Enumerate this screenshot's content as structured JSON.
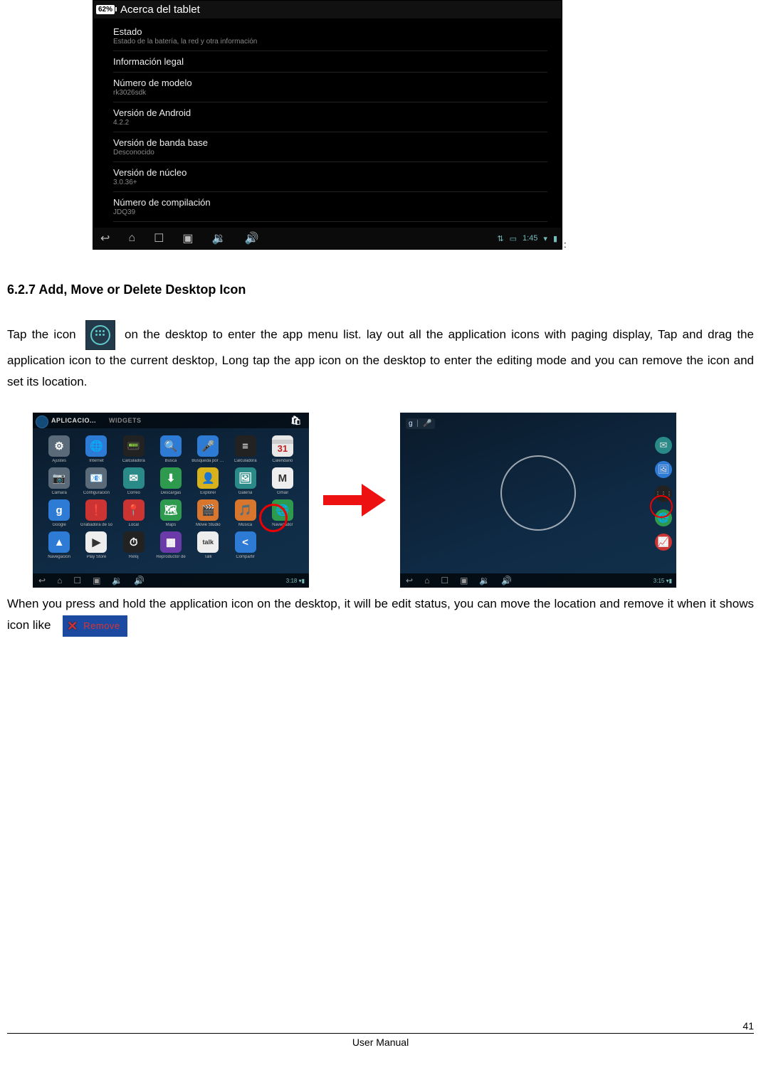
{
  "about": {
    "battery": "62%",
    "title": "Acerca del tablet",
    "items": [
      {
        "title": "Estado",
        "sub": "Estado de la batería, la red y otra información"
      },
      {
        "title": "Información legal",
        "sub": ""
      },
      {
        "title": "Número de modelo",
        "sub": "rk3026sdk"
      },
      {
        "title": "Versión de Android",
        "sub": "4.2.2"
      },
      {
        "title": "Versión de banda base",
        "sub": "Desconocido"
      },
      {
        "title": "Versión de núcleo",
        "sub": "3.0.36+"
      },
      {
        "title": "Número de compilación",
        "sub": "JDQ39"
      }
    ],
    "clock": "1:45"
  },
  "section_heading": "6.2.7 Add, Move or Delete Desktop Icon",
  "para1a": "Tap the icon",
  "para1b": "on the desktop to enter the app menu list.   lay out all the application icons with paging display, Tap and drag the application icon to the current desktop, Long tap the app icon on the desktop to enter the editing mode and you can remove the icon and set its location.",
  "left_shot": {
    "tab1": "APLICACIO...",
    "tab2": "WIDGETS",
    "apps": [
      {
        "lbl": "Ajustes",
        "g": "⚙",
        "cls": "bg-grey"
      },
      {
        "lbl": "Internet",
        "g": "🌐",
        "cls": "bg-blue"
      },
      {
        "lbl": "Calculadora",
        "g": "📟",
        "cls": "bg-dark"
      },
      {
        "lbl": "Busca",
        "g": "🔍",
        "cls": "bg-blue"
      },
      {
        "lbl": "Búsqueda por voz",
        "g": "🎤",
        "cls": "bg-blue"
      },
      {
        "lbl": "Calculadora",
        "g": "≡",
        "cls": "bg-dark"
      },
      {
        "lbl": "Calendario",
        "g": "31",
        "cls": "bg-cal"
      },
      {
        "lbl": "Cámara",
        "g": "📷",
        "cls": "bg-grey"
      },
      {
        "lbl": "Configuración",
        "g": "📧",
        "cls": "bg-grey"
      },
      {
        "lbl": "Correo",
        "g": "✉",
        "cls": "bg-teal"
      },
      {
        "lbl": "Descargas",
        "g": "⬇",
        "cls": "bg-green"
      },
      {
        "lbl": "Explorer",
        "g": "👤",
        "cls": "bg-yellow"
      },
      {
        "lbl": "Galería",
        "g": "🖼",
        "cls": "bg-teal"
      },
      {
        "lbl": "Gmail",
        "g": "M",
        "cls": "bg-white"
      },
      {
        "lbl": "Google",
        "g": "g",
        "cls": "bg-blue"
      },
      {
        "lbl": "Grabadora de so",
        "g": "❗",
        "cls": "bg-red"
      },
      {
        "lbl": "Local",
        "g": "📍",
        "cls": "bg-red"
      },
      {
        "lbl": "Maps",
        "g": "🗺",
        "cls": "bg-green"
      },
      {
        "lbl": "Movie Studio",
        "g": "🎬",
        "cls": "bg-orange"
      },
      {
        "lbl": "Música",
        "g": "🎵",
        "cls": "bg-orange"
      },
      {
        "lbl": "Navegador",
        "g": "🌐",
        "cls": "bg-green"
      },
      {
        "lbl": "Navegación",
        "g": "▲",
        "cls": "bg-blue"
      },
      {
        "lbl": "Play Store",
        "g": "▶",
        "cls": "bg-white"
      },
      {
        "lbl": "Reloj",
        "g": "⏱",
        "cls": "bg-dark"
      },
      {
        "lbl": "Reproductor de ",
        "g": "▦",
        "cls": "bg-purple"
      },
      {
        "lbl": "Talk",
        "g": "talk",
        "cls": "bg-white"
      },
      {
        "lbl": "Compartir",
        "g": "<",
        "cls": "bg-blue"
      }
    ],
    "nav_time": "3:18"
  },
  "right_shot": {
    "google_g": "g",
    "mic": "🎤",
    "dock": [
      {
        "g": "✉",
        "cls": "bg-teal"
      },
      {
        "g": "🖼",
        "cls": "bg-blue"
      },
      {
        "g": "⋮⋮⋮",
        "cls": "bg-dark"
      },
      {
        "g": "🌐",
        "cls": "bg-green"
      },
      {
        "g": "📈",
        "cls": "bg-red"
      }
    ],
    "nav_time": "3:15"
  },
  "para2a": "When you press and hold the application icon on the desktop, it will be edit status, you can move the location and remove it when it shows icon like",
  "remove_label": "Remove",
  "footer": {
    "center": "User Manual",
    "page": "41"
  }
}
